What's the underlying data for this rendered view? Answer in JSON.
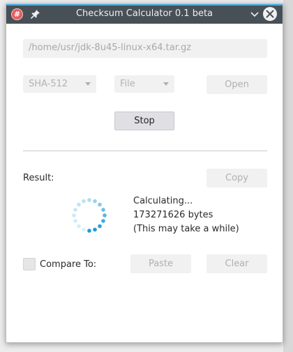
{
  "window": {
    "title": "Checksum Calculator 0.1 beta",
    "app_icon_glyph": "#",
    "controls": [
      "pin-icon",
      "minimize-icon",
      "close-icon"
    ]
  },
  "file_path": "/home/usr/jdk-8u45-linux-x64.tar.gz",
  "algorithm": "SHA-512",
  "source": "File",
  "buttons": {
    "open": "Open",
    "stop": "Stop",
    "copy": "Copy",
    "paste": "Paste",
    "clear": "Clear"
  },
  "result_label": "Result:",
  "status": {
    "line1": "Calculating...",
    "line2": "173271626 bytes",
    "line3": "(This may take a while)"
  },
  "compare_label": "Compare To:",
  "colors": {
    "accent": "#3daee9",
    "titlebar": "#475057",
    "spinner": "#1e9bd7"
  }
}
